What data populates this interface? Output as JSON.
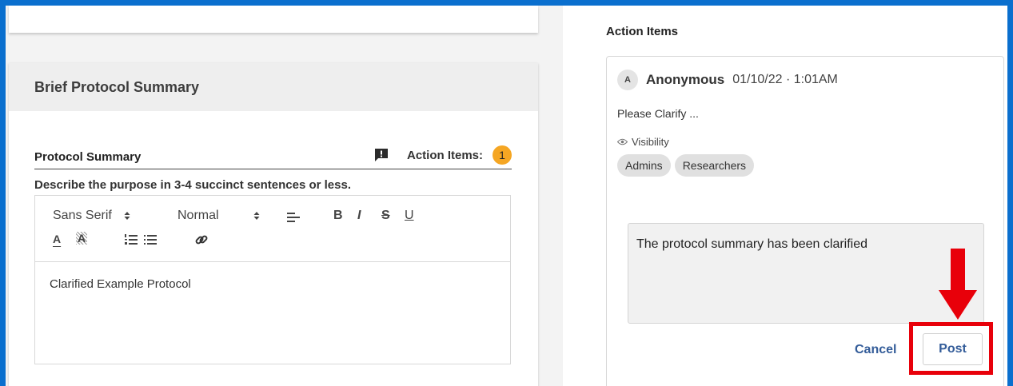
{
  "left": {
    "section_title": "Brief Protocol Summary",
    "field_label": "Protocol Summary",
    "action_items_label": "Action Items:",
    "action_items_count": "1",
    "description": "Describe the purpose in 3-4 succinct sentences or less.",
    "toolbar": {
      "font_select": "Sans Serif",
      "size_select": "Normal",
      "icons": [
        "align-icon",
        "bold-icon",
        "italic-icon",
        "strike-icon",
        "underline-icon",
        "text-color-icon",
        "background-color-icon",
        "ordered-list-icon",
        "bullet-list-icon",
        "link-icon"
      ],
      "bold": "B",
      "italic": "I",
      "strike": "S",
      "underline": "U",
      "text_color": "A",
      "background_color": "A"
    },
    "editor_content": "Clarified Example Protocol"
  },
  "right": {
    "title": "Action Items",
    "comment": {
      "avatar_letter": "A",
      "author": "Anonymous",
      "date": "01/10/22 · 1:01AM",
      "text": "Please Clarify ...",
      "visibility_label": "Visibility",
      "chips": [
        "Admins",
        "Researchers"
      ]
    },
    "reply_value": "The protocol summary has been clarified",
    "cancel_label": "Cancel",
    "post_label": "Post"
  },
  "colors": {
    "frame": "#0a6fce",
    "badge": "#f5a623",
    "link_blue": "#335c99",
    "annotation_red": "#e8000a"
  }
}
